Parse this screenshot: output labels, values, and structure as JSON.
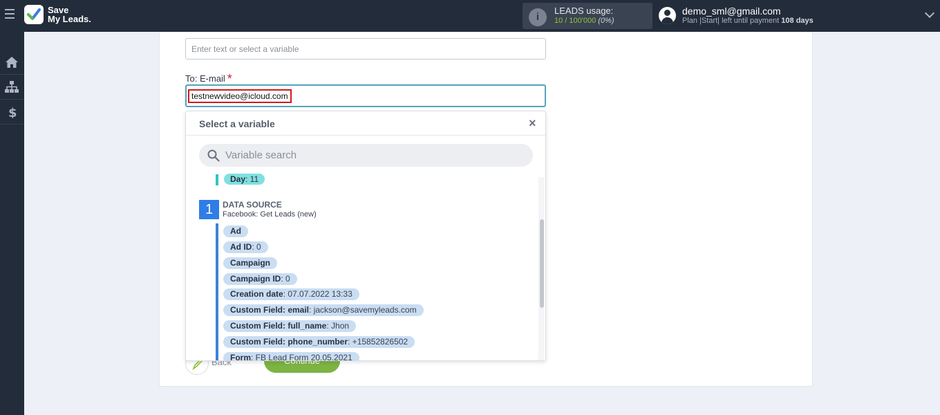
{
  "header": {
    "logo_line1": "Save",
    "logo_line2": "My Leads.",
    "usage_title": "LEADS usage:",
    "usage_count": "10 / 100'000",
    "usage_pct": "(0%)",
    "user_email": "demo_sml@gmail.com",
    "plan_prefix": "Plan |Start| left until payment ",
    "plan_days": "108 days"
  },
  "form": {
    "top_input_placeholder": "Enter text or select a variable",
    "to_label": "To: E-mail",
    "required_mark": "*",
    "email_value": "testnewvideo@icloud.com"
  },
  "buttons": {
    "back": "Back",
    "continue": "Continue"
  },
  "dropdown": {
    "title": "Select a variable",
    "close": "×",
    "search_placeholder": "Variable search",
    "prev_item": {
      "key": "Day",
      "value": ": 11"
    },
    "source_num": "1",
    "source_title": "DATA SOURCE",
    "source_sub": "Facebook: Get Leads (new)",
    "variables": [
      {
        "key": "Ad",
        "value": ""
      },
      {
        "key": "Ad ID",
        "value": ": 0"
      },
      {
        "key": "Campaign",
        "value": ""
      },
      {
        "key": "Campaign ID",
        "value": ": 0"
      },
      {
        "key": "Creation date",
        "value": ": 07.07.2022 13:33"
      },
      {
        "key": "Custom Field: email",
        "value": ": jackson@savemyleads.com"
      },
      {
        "key": "Custom Field: full_name",
        "value": ": Jhon"
      },
      {
        "key": "Custom Field: phone_number",
        "value": ": +15852826502"
      },
      {
        "key": "Form",
        "value": ": FB Lead Form 20.05.2021"
      }
    ]
  },
  "colors": {
    "topbar": "#232c3a",
    "accent_green": "#7cb342",
    "source_blue": "#2f7de6",
    "highlight_red": "#d11b1b"
  }
}
